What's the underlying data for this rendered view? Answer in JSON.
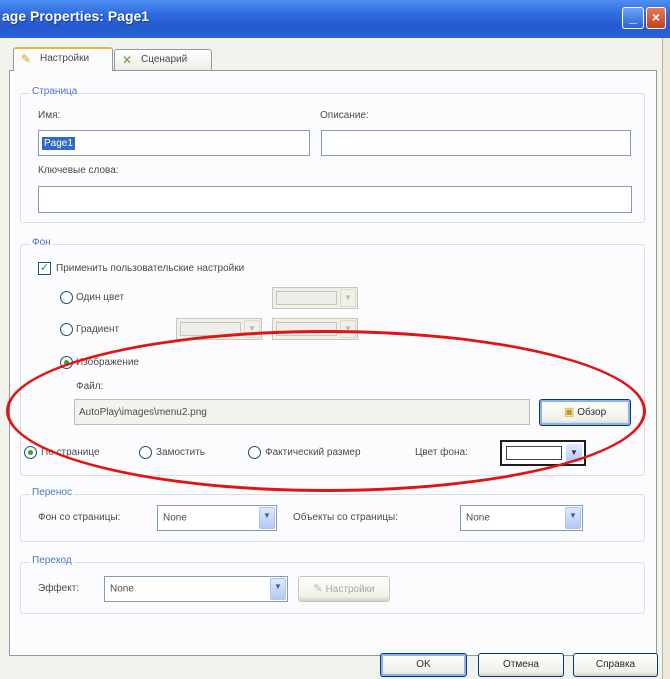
{
  "window": {
    "title": "age Properties: Page1",
    "minimize_glyph": "_",
    "close_glyph": "×"
  },
  "tabs": [
    {
      "label": "Настройки",
      "active": true,
      "icon": "settings-icon"
    },
    {
      "label": "Сценарий",
      "active": false,
      "icon": "script-icon"
    }
  ],
  "page_group": {
    "legend": "Страница",
    "name_label": "Имя:",
    "name_value": "Page1",
    "description_label": "Описание:",
    "description_value": "",
    "keywords_label": "Ключевые слова:",
    "keywords_value": ""
  },
  "background_group": {
    "legend": "Фон",
    "custom_checkbox_label": "Применить пользовательские настройки",
    "custom_checked": true,
    "solid_color_label": "Один цвет",
    "gradient_label": "Градиент",
    "image_label": "Изображение",
    "selected_mode": "image",
    "file_label": "Файл:",
    "file_value": "AutoPlay\\images\\menu2.png",
    "browse_label": "Обзор",
    "fit_page_label": "По странице",
    "tile_label": "Замостить",
    "actual_size_label": "Фактический размер",
    "selected_fit": "fit_page",
    "bg_color_label": "Цвет фона:",
    "bg_color_value": "#ffffff"
  },
  "transfer_group": {
    "legend": "Перенос",
    "bg_from_page_label": "Фон со страницы:",
    "bg_from_page_value": "None",
    "objects_from_page_label": "Объекты со страницы:",
    "objects_from_page_value": "None"
  },
  "transition_group": {
    "legend": "Переход",
    "effect_label": "Эффект:",
    "effect_value": "None",
    "settings_button_label": "Настройки"
  },
  "footer": {
    "ok_label": "OK",
    "cancel_label": "Отмена",
    "help_label": "Справка"
  },
  "colors": {
    "title_bar": "#2f6de0",
    "highlight_ellipse": "#e11414",
    "selection": "#316ac5"
  }
}
